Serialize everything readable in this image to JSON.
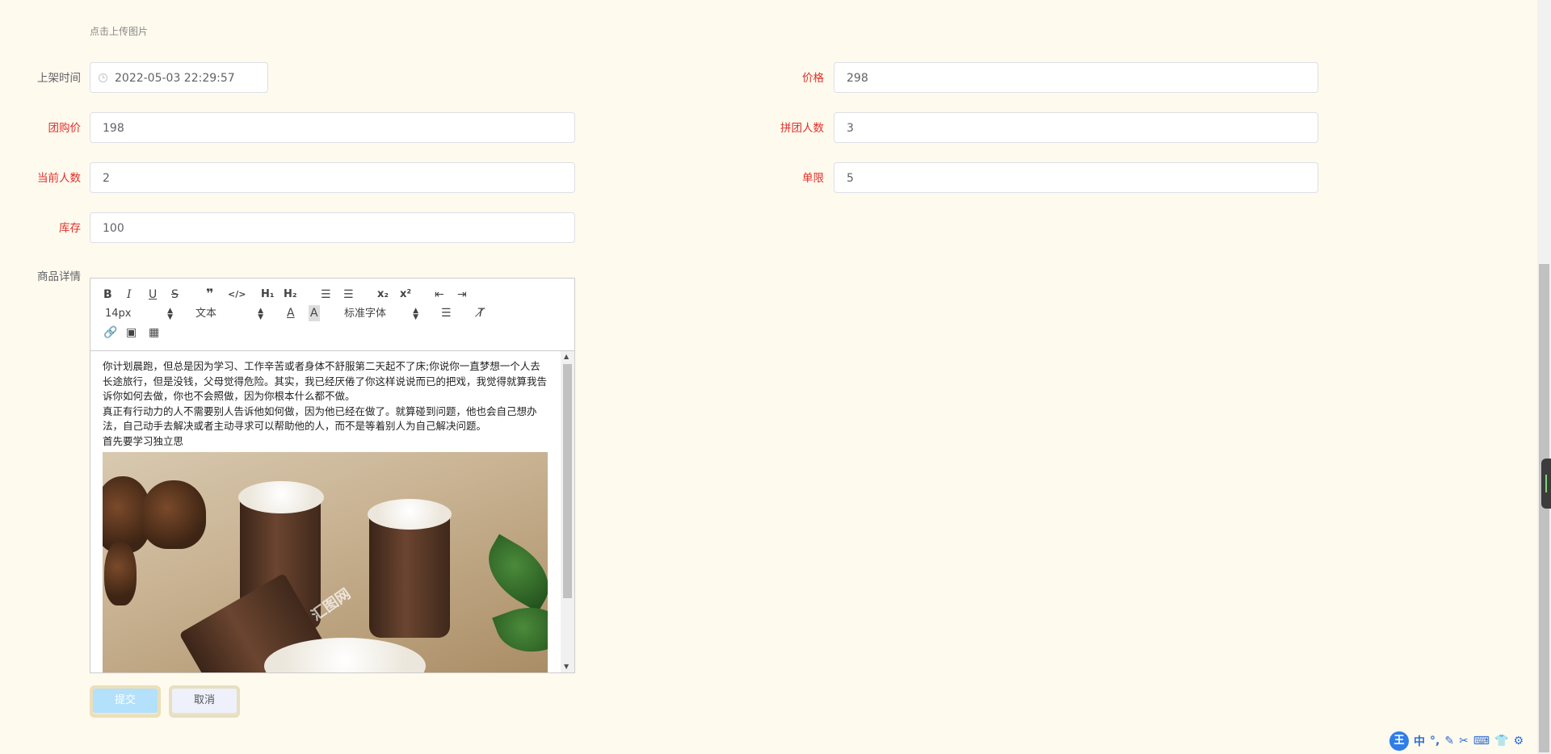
{
  "upload": {
    "hint": "点击上传图片"
  },
  "form": {
    "listing_time": {
      "label": "上架时间",
      "value": "2022-05-03 22:29:57"
    },
    "price": {
      "label": "价格",
      "value": "298"
    },
    "group_price": {
      "label": "团购价",
      "value": "198"
    },
    "group_size": {
      "label": "拼团人数",
      "value": "3"
    },
    "current_count": {
      "label": "当前人数",
      "value": "2"
    },
    "limit": {
      "label": "单限",
      "value": "5"
    },
    "stock": {
      "label": "库存",
      "value": "100"
    },
    "details": {
      "label": "商品详情"
    }
  },
  "editor": {
    "toolbar": {
      "bold": "B",
      "italic": "I",
      "underline": "U",
      "strike": "S",
      "quote": "❞",
      "code": "</>",
      "h1": "H₁",
      "h2": "H₂",
      "ordered_list": "☰",
      "bullet_list": "☰",
      "sub": "x₂",
      "sup": "x²",
      "outdent": "⇤",
      "indent": "⇥",
      "size": "14px",
      "header": "文本",
      "font": "标准字体",
      "align": "☰",
      "clean": "T̸"
    },
    "paragraphs": [
      "你计划晨跑，但总是因为学习、工作辛苦或者身体不舒服第二天起不了床;你说你一直梦想一个人去长途旅行，但是没钱，父母觉得危险。其实，我已经厌倦了你这样说说而已的把戏，我觉得就算我告诉你如何去做，你也不会照做，因为你根本什么都不做。",
      "真正有行动力的人不需要别人告诉他如何做，因为他已经在做了。就算碰到问题，他也会自己想办法，自己动手去解决或者主动寻求可以帮助他的人，而不是等着别人为自己解决问题。",
      "首先要学习独立思"
    ],
    "image_watermark": "汇图网"
  },
  "buttons": {
    "submit": "提交",
    "cancel": "取消"
  },
  "ime": {
    "mode": "中"
  }
}
